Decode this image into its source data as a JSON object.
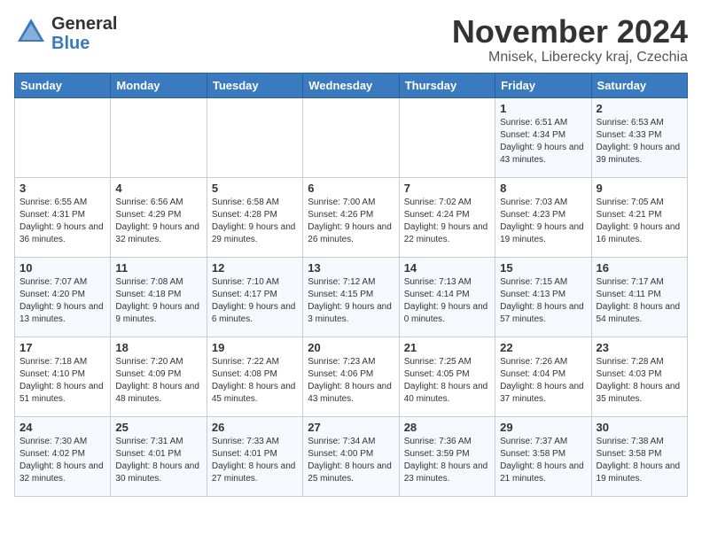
{
  "header": {
    "logo_general": "General",
    "logo_blue": "Blue",
    "month_title": "November 2024",
    "subtitle": "Mnisek, Liberecky kraj, Czechia"
  },
  "weekdays": [
    "Sunday",
    "Monday",
    "Tuesday",
    "Wednesday",
    "Thursday",
    "Friday",
    "Saturday"
  ],
  "weeks": [
    [
      {
        "day": "",
        "info": ""
      },
      {
        "day": "",
        "info": ""
      },
      {
        "day": "",
        "info": ""
      },
      {
        "day": "",
        "info": ""
      },
      {
        "day": "",
        "info": ""
      },
      {
        "day": "1",
        "info": "Sunrise: 6:51 AM\nSunset: 4:34 PM\nDaylight: 9 hours\nand 43 minutes."
      },
      {
        "day": "2",
        "info": "Sunrise: 6:53 AM\nSunset: 4:33 PM\nDaylight: 9 hours\nand 39 minutes."
      }
    ],
    [
      {
        "day": "3",
        "info": "Sunrise: 6:55 AM\nSunset: 4:31 PM\nDaylight: 9 hours\nand 36 minutes."
      },
      {
        "day": "4",
        "info": "Sunrise: 6:56 AM\nSunset: 4:29 PM\nDaylight: 9 hours\nand 32 minutes."
      },
      {
        "day": "5",
        "info": "Sunrise: 6:58 AM\nSunset: 4:28 PM\nDaylight: 9 hours\nand 29 minutes."
      },
      {
        "day": "6",
        "info": "Sunrise: 7:00 AM\nSunset: 4:26 PM\nDaylight: 9 hours\nand 26 minutes."
      },
      {
        "day": "7",
        "info": "Sunrise: 7:02 AM\nSunset: 4:24 PM\nDaylight: 9 hours\nand 22 minutes."
      },
      {
        "day": "8",
        "info": "Sunrise: 7:03 AM\nSunset: 4:23 PM\nDaylight: 9 hours\nand 19 minutes."
      },
      {
        "day": "9",
        "info": "Sunrise: 7:05 AM\nSunset: 4:21 PM\nDaylight: 9 hours\nand 16 minutes."
      }
    ],
    [
      {
        "day": "10",
        "info": "Sunrise: 7:07 AM\nSunset: 4:20 PM\nDaylight: 9 hours\nand 13 minutes."
      },
      {
        "day": "11",
        "info": "Sunrise: 7:08 AM\nSunset: 4:18 PM\nDaylight: 9 hours\nand 9 minutes."
      },
      {
        "day": "12",
        "info": "Sunrise: 7:10 AM\nSunset: 4:17 PM\nDaylight: 9 hours\nand 6 minutes."
      },
      {
        "day": "13",
        "info": "Sunrise: 7:12 AM\nSunset: 4:15 PM\nDaylight: 9 hours\nand 3 minutes."
      },
      {
        "day": "14",
        "info": "Sunrise: 7:13 AM\nSunset: 4:14 PM\nDaylight: 9 hours\nand 0 minutes."
      },
      {
        "day": "15",
        "info": "Sunrise: 7:15 AM\nSunset: 4:13 PM\nDaylight: 8 hours\nand 57 minutes."
      },
      {
        "day": "16",
        "info": "Sunrise: 7:17 AM\nSunset: 4:11 PM\nDaylight: 8 hours\nand 54 minutes."
      }
    ],
    [
      {
        "day": "17",
        "info": "Sunrise: 7:18 AM\nSunset: 4:10 PM\nDaylight: 8 hours\nand 51 minutes."
      },
      {
        "day": "18",
        "info": "Sunrise: 7:20 AM\nSunset: 4:09 PM\nDaylight: 8 hours\nand 48 minutes."
      },
      {
        "day": "19",
        "info": "Sunrise: 7:22 AM\nSunset: 4:08 PM\nDaylight: 8 hours\nand 45 minutes."
      },
      {
        "day": "20",
        "info": "Sunrise: 7:23 AM\nSunset: 4:06 PM\nDaylight: 8 hours\nand 43 minutes."
      },
      {
        "day": "21",
        "info": "Sunrise: 7:25 AM\nSunset: 4:05 PM\nDaylight: 8 hours\nand 40 minutes."
      },
      {
        "day": "22",
        "info": "Sunrise: 7:26 AM\nSunset: 4:04 PM\nDaylight: 8 hours\nand 37 minutes."
      },
      {
        "day": "23",
        "info": "Sunrise: 7:28 AM\nSunset: 4:03 PM\nDaylight: 8 hours\nand 35 minutes."
      }
    ],
    [
      {
        "day": "24",
        "info": "Sunrise: 7:30 AM\nSunset: 4:02 PM\nDaylight: 8 hours\nand 32 minutes."
      },
      {
        "day": "25",
        "info": "Sunrise: 7:31 AM\nSunset: 4:01 PM\nDaylight: 8 hours\nand 30 minutes."
      },
      {
        "day": "26",
        "info": "Sunrise: 7:33 AM\nSunset: 4:01 PM\nDaylight: 8 hours\nand 27 minutes."
      },
      {
        "day": "27",
        "info": "Sunrise: 7:34 AM\nSunset: 4:00 PM\nDaylight: 8 hours\nand 25 minutes."
      },
      {
        "day": "28",
        "info": "Sunrise: 7:36 AM\nSunset: 3:59 PM\nDaylight: 8 hours\nand 23 minutes."
      },
      {
        "day": "29",
        "info": "Sunrise: 7:37 AM\nSunset: 3:58 PM\nDaylight: 8 hours\nand 21 minutes."
      },
      {
        "day": "30",
        "info": "Sunrise: 7:38 AM\nSunset: 3:58 PM\nDaylight: 8 hours\nand 19 minutes."
      }
    ]
  ]
}
